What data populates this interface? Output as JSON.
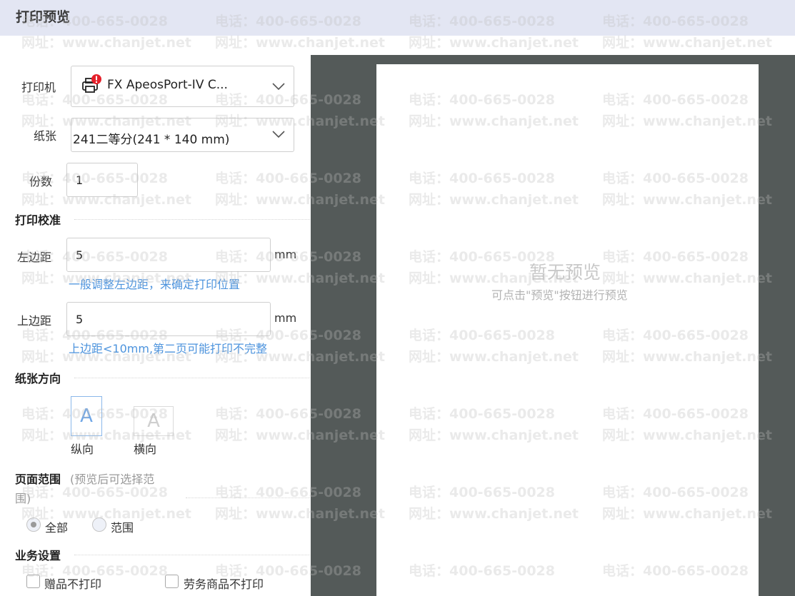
{
  "header": {
    "title": "打印预览"
  },
  "printer": {
    "label": "打印机",
    "value": "FX ApeosPort-IV C...",
    "icon": "printer-warning-icon"
  },
  "paper": {
    "label": "纸张",
    "value": "241二等分(241  * 140  mm)"
  },
  "copies": {
    "label": "份数",
    "value": "1"
  },
  "calibration": {
    "title": "打印校准",
    "left_margin": {
      "label": "左边距",
      "value": "5",
      "unit": "mm",
      "hint": "一般调整左边距，来确定打印位置"
    },
    "top_margin": {
      "label": "上边距",
      "value": "5",
      "unit": "mm",
      "hint": "上边距<10mm,第二页可能打印不完整"
    }
  },
  "orientation": {
    "title": "纸张方向",
    "portrait": {
      "glyph": "A",
      "label": "纵向"
    },
    "landscape": {
      "glyph": "A",
      "label": "横向"
    }
  },
  "page_range": {
    "title": "页面范围",
    "note_line1": "(预览后可选择范",
    "note_line2": "围)",
    "options": [
      "全部",
      "范围"
    ],
    "selected": "全部"
  },
  "business": {
    "title": "业务设置",
    "options": [
      "赠品不打印",
      "劳务商品不打印"
    ]
  },
  "preview": {
    "empty_title": "暂无预览",
    "empty_sub": "可点击\"预览\"按钮进行预览"
  },
  "watermark": {
    "phone": "电话：400-665-0028",
    "site": "网址：www.chanjet.net"
  },
  "colors": {
    "header_bg": "#e3e6f3",
    "accent_blue": "#4c93dd",
    "preview_bg": "#545a59",
    "warning_red": "#e5202a"
  }
}
